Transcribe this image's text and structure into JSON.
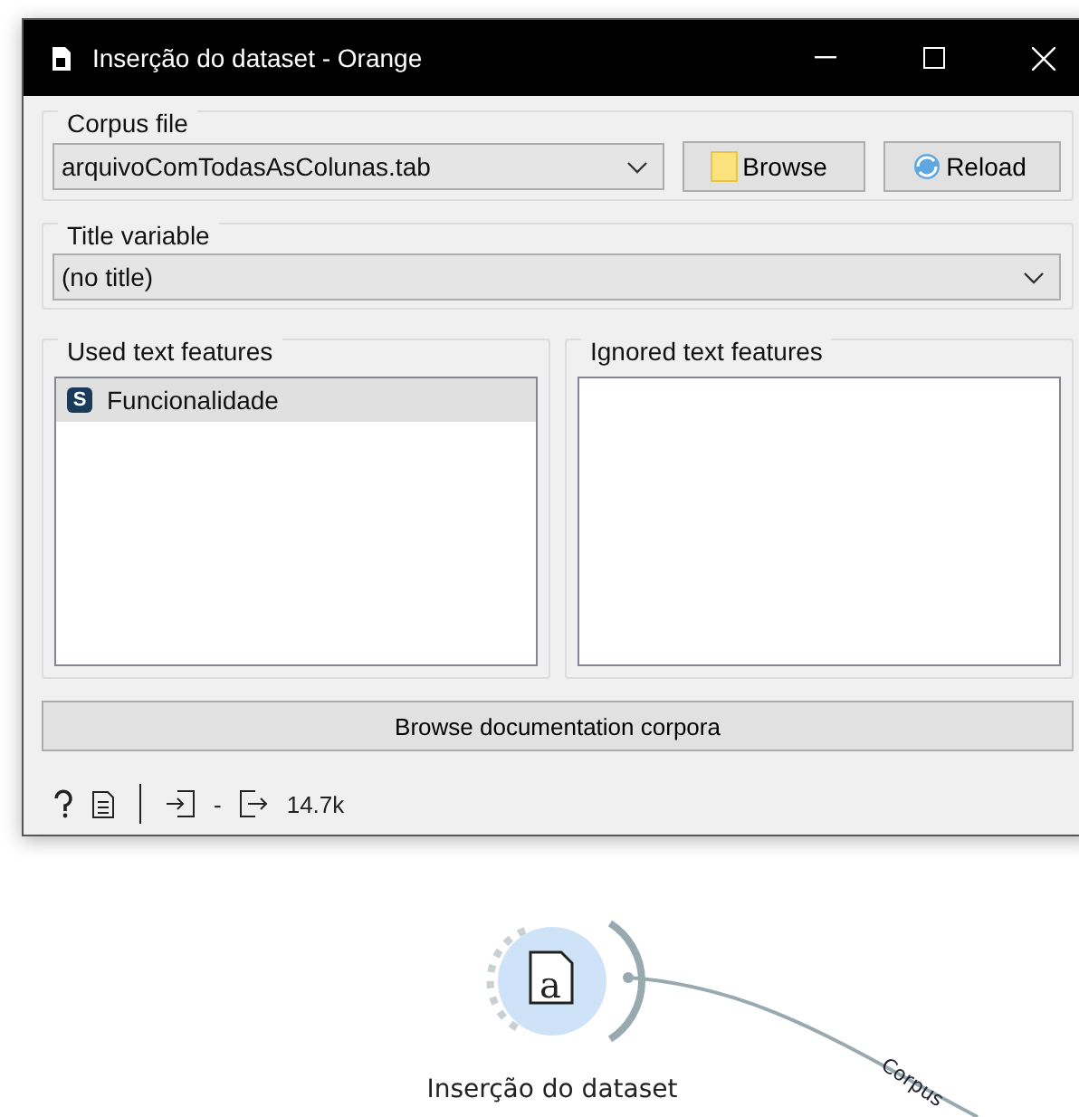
{
  "window": {
    "title": "Inserção do dataset - Orange"
  },
  "corpus_file": {
    "label": "Corpus file",
    "value": "arquivoComTodasAsColunas.tab",
    "buttons": [
      "Browse",
      "Reload"
    ]
  },
  "title_variable": {
    "label": "Title variable",
    "value": "(no title)"
  },
  "used_text_features": {
    "label": "Used text features",
    "items": [
      {
        "type_badge": "S",
        "name": "Funcionalidade",
        "selected": true
      }
    ]
  },
  "ignored_text_features": {
    "label": "Ignored text features"
  },
  "browse_docs_button": "Browse documentation corpora",
  "status_bar": {
    "input": "-",
    "output": "14.7k"
  },
  "canvas": {
    "node": {
      "icon_letter": "a",
      "label": "Inserção do dataset"
    },
    "link": {
      "label": "Corpus"
    }
  }
}
